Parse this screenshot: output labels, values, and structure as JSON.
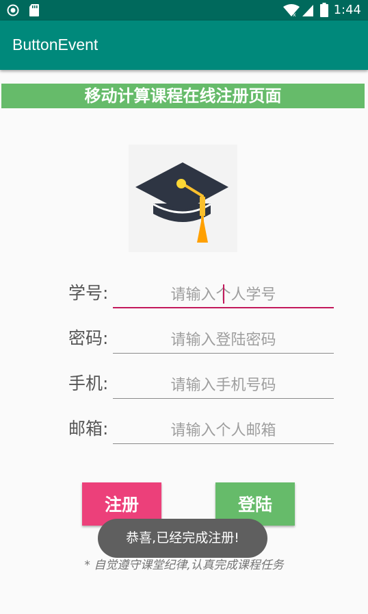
{
  "status_bar": {
    "time": "1:44",
    "icons": [
      "circle-notification-icon",
      "sd-card-icon",
      "wifi-icon",
      "signal-icon",
      "battery-icon"
    ]
  },
  "app_bar": {
    "title": "ButtonEvent"
  },
  "banner": {
    "title": "移动计算课程在线注册页面"
  },
  "logo": {
    "icon": "graduation-cap-icon"
  },
  "form": {
    "fields": [
      {
        "label": "学号:",
        "placeholder": "请输入个人学号",
        "value": ""
      },
      {
        "label": "密码:",
        "placeholder": "请输入登陆密码",
        "value": ""
      },
      {
        "label": "手机:",
        "placeholder": "请输入手机号码",
        "value": ""
      },
      {
        "label": "邮箱:",
        "placeholder": "请输入个人邮箱",
        "value": ""
      }
    ]
  },
  "buttons": {
    "register": "注册",
    "login": "登陆"
  },
  "footer": {
    "note": "* 自觉遵守课堂纪律,认真完成课程任务"
  },
  "toast": {
    "message": "恭喜,已经完成注册!"
  },
  "colors": {
    "status_bar": "#00695c",
    "app_bar": "#00897b",
    "banner": "#66bb6a",
    "register_button": "#ec407a",
    "login_button": "#66bb6a",
    "active_underline": "#c2185b"
  }
}
